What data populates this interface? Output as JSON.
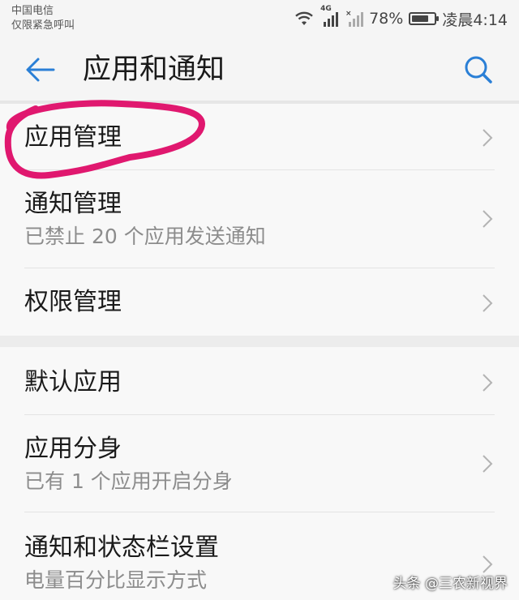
{
  "status_bar": {
    "carrier_line1": "中国电信",
    "carrier_line2": "仅限紧急呼叫",
    "network": "4G",
    "battery_percent_text": "78%",
    "battery_level": 0.78,
    "time": "凌晨4:14",
    "icons": [
      "wifi-icon",
      "signal-icon",
      "no-signal-icon",
      "battery-icon"
    ]
  },
  "toolbar": {
    "title": "应用和通知",
    "back_icon": "back-arrow-icon",
    "search_icon": "search-icon",
    "accent_color": "#2a7fd6"
  },
  "groups": [
    {
      "items": [
        {
          "label": "应用管理",
          "subtitle": "",
          "highlighted": true
        },
        {
          "label": "通知管理",
          "subtitle": "已禁止 20 个应用发送通知"
        },
        {
          "label": "权限管理",
          "subtitle": ""
        }
      ]
    },
    {
      "items": [
        {
          "label": "默认应用",
          "subtitle": ""
        },
        {
          "label": "应用分身",
          "subtitle": "已有 1 个应用开启分身"
        },
        {
          "label": "通知和状态栏设置",
          "subtitle": "电量百分比显示方式"
        }
      ]
    }
  ],
  "annotation_color": "#e0186f",
  "watermark": "头条 @三农新视界"
}
